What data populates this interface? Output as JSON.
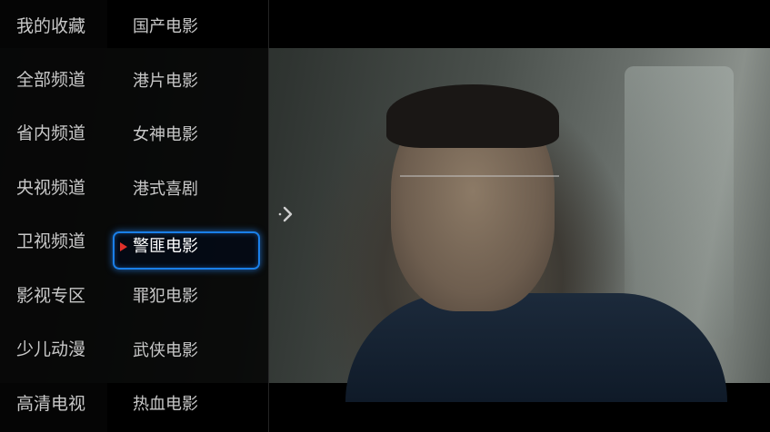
{
  "categories": [
    {
      "label": "我的收藏"
    },
    {
      "label": "全部频道"
    },
    {
      "label": "省内频道"
    },
    {
      "label": "央视频道"
    },
    {
      "label": "卫视频道"
    },
    {
      "label": "影视专区"
    },
    {
      "label": "少儿动漫"
    },
    {
      "label": "高清电视"
    }
  ],
  "subcategories": [
    {
      "label": "国产电影"
    },
    {
      "label": "港片电影"
    },
    {
      "label": "女神电影"
    },
    {
      "label": "港式喜剧"
    },
    {
      "label": "警匪电影"
    },
    {
      "label": "罪犯电影"
    },
    {
      "label": "武侠电影"
    },
    {
      "label": "热血电影"
    }
  ],
  "selected_subcategory": "警匪电影",
  "colors": {
    "focus_border": "#1a7fe8",
    "play_marker": "#e0302a",
    "text": "#c8c8c8",
    "selected_text": "#ffffff"
  },
  "icons": {
    "play_marker": "play-triangle-icon",
    "expand": "expand-arrow-icon"
  }
}
